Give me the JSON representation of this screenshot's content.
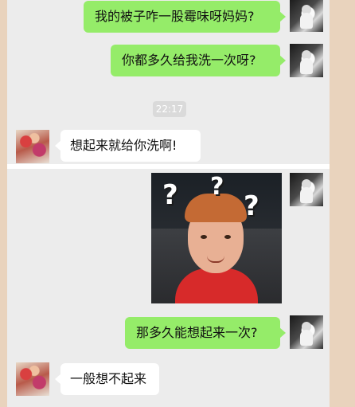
{
  "messages": [
    {
      "side": "out",
      "text": "我的被子咋一股霉味呀妈妈?"
    },
    {
      "side": "out",
      "text": "你都多久给我洗一次呀?"
    },
    {
      "side": "in",
      "text": "想起来就给你洗啊!"
    },
    {
      "side": "out",
      "text": "那多久能想起来一次?"
    },
    {
      "side": "in",
      "text": "一般想不起来"
    }
  ],
  "timestamp": "22:17",
  "photo_marks": [
    "?",
    "?",
    "?"
  ],
  "colors": {
    "outgoing_bubble": "#95ec69",
    "incoming_bubble": "#ffffff",
    "chat_background": "#ececec",
    "frame": "#e9d3bd",
    "time_badge": "#dadada"
  }
}
